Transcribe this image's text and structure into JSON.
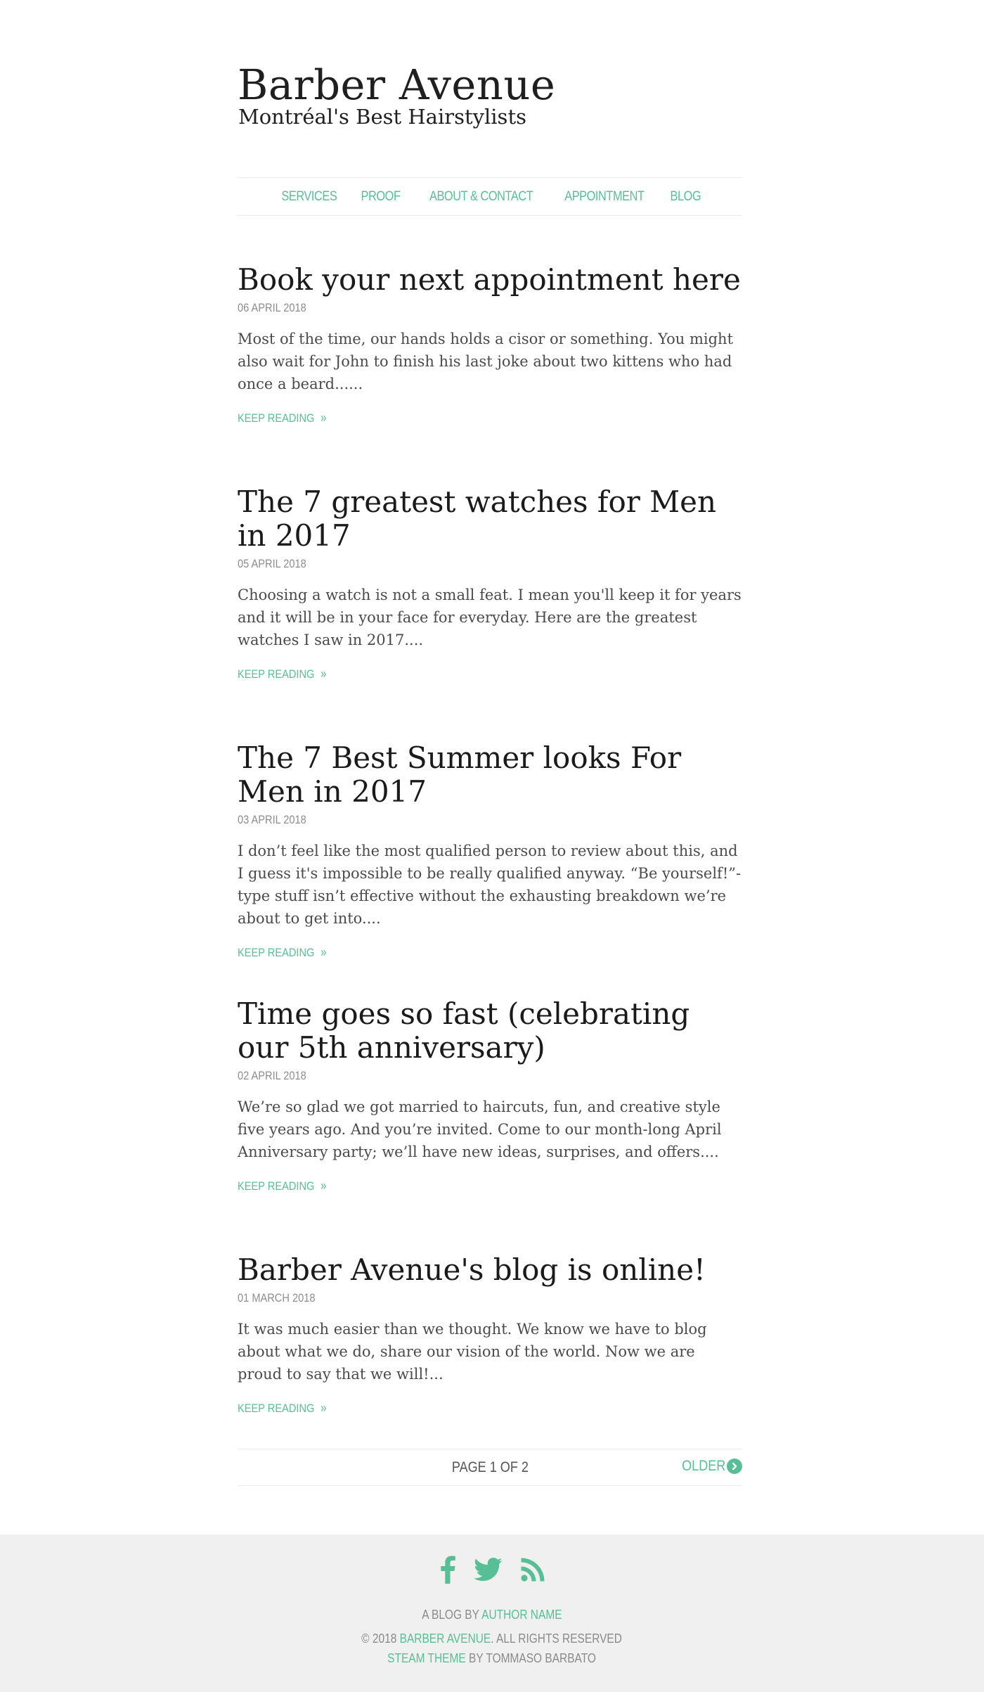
{
  "site": {
    "title": "Barber Avenue",
    "subtitle": "Montréal's Best Hairstylists"
  },
  "nav": {
    "items": [
      {
        "label": "SERVICES"
      },
      {
        "label": "PROOF"
      },
      {
        "label": "ABOUT & CONTACT"
      },
      {
        "label": "APPOINTMENT"
      },
      {
        "label": "BLOG"
      }
    ]
  },
  "posts": [
    {
      "title": "Book your next appointment here",
      "date": "06 APRIL 2018",
      "excerpt": "Most of the time, our hands holds a cisor or something. You might also wait for John to finish his last joke about two kittens who had once a beard......",
      "link": "KEEP READING"
    },
    {
      "title": "The 7 greatest watches for Men in 2017",
      "date": "05 APRIL 2018",
      "excerpt": "Choosing a watch is not a small feat. I mean you'll keep it for years and it will be in your face for everyday. Here are the greatest watches I saw in 2017....",
      "link": "KEEP READING"
    },
    {
      "title": "The 7 Best Summer looks For Men in 2017",
      "date": "03 APRIL 2018",
      "excerpt": "I don’t feel like the most qualified person to review about this, and I guess it's impossible to be really qualified anyway. “Be yourself!”-type stuff isn’t effective without the exhausting breakdown we’re about to get into....",
      "link": "KEEP READING"
    },
    {
      "title": "Time goes so fast (celebrating our 5th anniversary)",
      "date": "02 APRIL 2018",
      "excerpt": "We’re so glad we got married to haircuts, fun, and creative style five years ago. And you’re invited. Come to our month-long April Anniversary party; we’ll have new ideas, surprises, and offers....",
      "link": "KEEP READING"
    },
    {
      "title": "Barber Avenue's blog is online!",
      "date": "01 MARCH 2018",
      "excerpt": "It was much easier than we thought. We know we have to blog about what we do, share our vision of the world. Now we are proud to say that we will!...",
      "link": "KEEP READING"
    }
  ],
  "pager": {
    "label": "PAGE 1 OF 2",
    "older": "OLDER"
  },
  "footer": {
    "social": [
      "facebook-icon",
      "twitter-icon",
      "rss-icon"
    ],
    "byline_prefix": "A BLOG BY",
    "author": "AUTHOR NAME",
    "copyright_prefix": "© 2018",
    "brand": "BARBER AVENUE",
    "rights": ". ALL RIGHTS RESERVED",
    "theme": "STEAM THEME",
    "theme_by": "BY TOMMASO BARBATO"
  },
  "colors": {
    "accent": "#57bf95",
    "footer_bg": "#f0f0f0"
  }
}
